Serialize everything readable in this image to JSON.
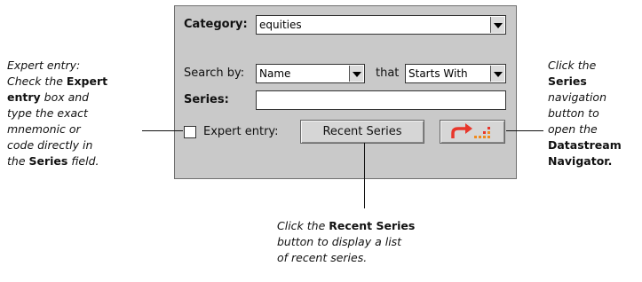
{
  "panel": {
    "category_label": "Category:",
    "category_value": "equities",
    "search_by_label": "Search by:",
    "search_by_value": "Name",
    "that_label": "that",
    "match_value": "Starts With",
    "series_label": "Series:",
    "series_value": "",
    "expert_label": "Expert entry:",
    "expert_checked": false,
    "recent_series_button": "Recent Series",
    "nav_icon": "datastream-navigator-icon",
    "nav_colors": [
      "#e8362b",
      "#f08a1c"
    ]
  },
  "callouts": {
    "left": [
      "Expert entry:",
      "Check the ",
      "Expert",
      "entry",
      " box and",
      "type the exact",
      "mnemonic or",
      "code directly in",
      "the ",
      "Series",
      " field."
    ],
    "right": [
      "Click the",
      "Series",
      "navigation",
      "button to",
      "open the",
      "Datastream",
      "Navigator."
    ],
    "bottom": [
      "Click the ",
      "Recent Series",
      "button to display a list",
      "of recent series."
    ]
  }
}
